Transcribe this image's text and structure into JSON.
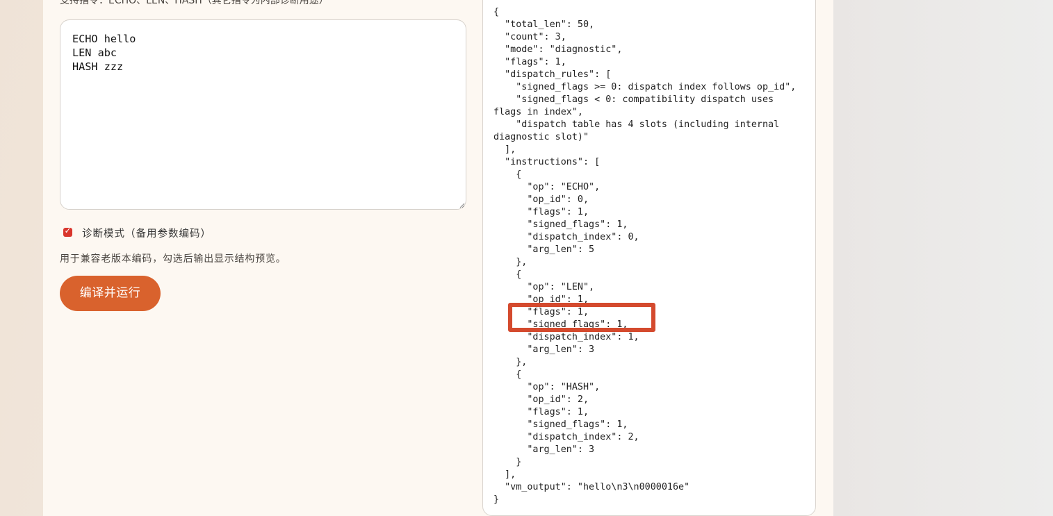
{
  "top_hint": "支持指令：ECHO、LEN、HASH（其它指令为内部诊断用途）",
  "editor": {
    "value": "ECHO hello\nLEN abc\nHASH zzz"
  },
  "diagnostic": {
    "label": "诊断模式（备用参数编码）",
    "checked": true,
    "description": "用于兼容老版本编码，勾选后输出显示结构预览。"
  },
  "run_button": {
    "label": "编译并运行"
  },
  "output": {
    "text": "{\n  \"total_len\": 50,\n  \"count\": 3,\n  \"mode\": \"diagnostic\",\n  \"flags\": 1,\n  \"dispatch_rules\": [\n    \"signed_flags >= 0: dispatch index follows op_id\",\n    \"signed_flags < 0: compatibility dispatch uses\nflags in index\",\n    \"dispatch table has 4 slots (including internal\ndiagnostic slot)\"\n  ],\n  \"instructions\": [\n    {\n      \"op\": \"ECHO\",\n      \"op_id\": 0,\n      \"flags\": 1,\n      \"signed_flags\": 1,\n      \"dispatch_index\": 0,\n      \"arg_len\": 5\n    },\n    {\n      \"op\": \"LEN\",\n      \"op_id\": 1,\n      \"flags\": 1,\n      \"signed_flags\": 1,\n      \"dispatch_index\": 1,\n      \"arg_len\": 3\n    },\n    {\n      \"op\": \"HASH\",\n      \"op_id\": 2,\n      \"flags\": 1,\n      \"signed_flags\": 1,\n      \"dispatch_index\": 2,\n      \"arg_len\": 3\n    }\n  ],\n  \"vm_output\": \"hello\\n3\\n0000016e\"\n}"
  },
  "colors": {
    "accent": "#d9622d",
    "checkbox": "#d9362d",
    "highlight_box": "#d44a2e"
  }
}
